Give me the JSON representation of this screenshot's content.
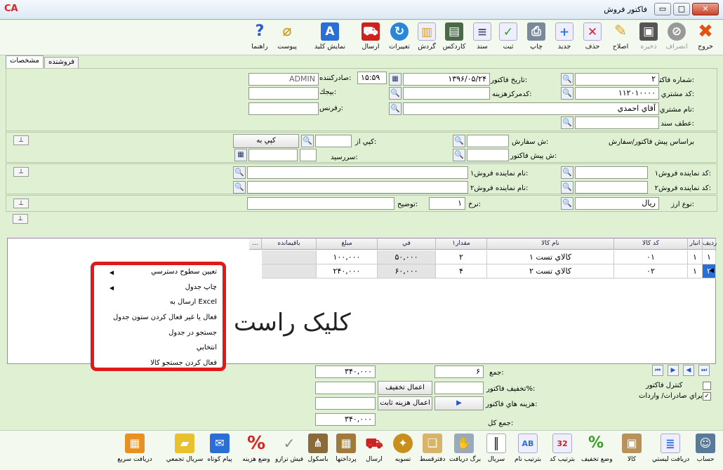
{
  "window": {
    "title": "فاکتور فروش",
    "logo": "CA"
  },
  "toolbar": {
    "exit": "خروج",
    "cancel": "انصراف",
    "save": "ذخيره",
    "edit": "اصلاح",
    "delete": "حذف",
    "new": "جديد",
    "print": "چاپ",
    "register": "ثبت",
    "document": "سند",
    "cardex": "کاردکس",
    "turnover": "گردش",
    "changes": "تغييرات",
    "send": "ارسال",
    "show_keys": "نمايش کليد",
    "attachment": "پيوست",
    "help": "راهنما"
  },
  "tabs": {
    "specs": "مشخصات",
    "seller": "فروشنده"
  },
  "header": {
    "invoice_no_label": "شماره فاکتور:",
    "invoice_no": "۲",
    "invoice_date_label": "تاريخ فاکتور:",
    "invoice_date": "۱۳۹۶/۰۵/۲۴",
    "time": "۱۵:۵۹",
    "issuer_label": "صادرکننده:",
    "issuer": "ADMIN",
    "customer_code_label": "کد مشتري:",
    "customer_code": "۱۱۲۰۱۰۰۰۰",
    "cost_center_label": "کدمرکزهزينه:",
    "budget_label": "بيجك:",
    "customer_name_label": "نام مشتري:",
    "customer_name": "آقاي احمدي",
    "reference_label": "رفرنس:",
    "doc_ref_label": "عطف سند:"
  },
  "order": {
    "based_on_label": "براساس پيش فاکتور/سفارش",
    "order_no_label": "ش سفارش:",
    "proforma_no_label": "ش پيش فاکتور:",
    "copy_from_label": "کپي از:",
    "copy_to_button": "کپي به",
    "due_label": "سررسيد:"
  },
  "sales_rep": {
    "code1_label": "کد نماينده فروش۱:",
    "name1_label": "نام نماينده فروش۱:",
    "code2_label": "کد نماينده فروش۲:",
    "name2_label": "نام نماينده فروش۲:"
  },
  "currency": {
    "type_label": "نوع ارز:",
    "type": "ريال",
    "rate_label": "نرخ:",
    "rate": "۱",
    "desc_label": "توضيح:"
  },
  "grid": {
    "columns": [
      "رديف",
      "انبار",
      "کد کالا",
      "نام کالا",
      "مقدار۱",
      "في",
      "مبلغ",
      "باقيمانده",
      "..."
    ],
    "rows": [
      {
        "row": "۱",
        "warehouse": "۱",
        "code": "۰۱",
        "name": "کالاي تست ۱",
        "qty": "۲",
        "price": "۵۰,۰۰۰",
        "amount": "۱۰۰,۰۰۰",
        "remain": ""
      },
      {
        "row": "۲",
        "warehouse": "۱",
        "code": "۰۲",
        "name": "کالاي تست ۲",
        "qty": "۴",
        "price": "۶۰,۰۰۰",
        "amount": "۲۴۰,۰۰۰",
        "remain": ""
      }
    ]
  },
  "context_menu": {
    "access_levels": "تعيين سطوح دسترسي",
    "print_table": "چاپ جدول",
    "send_excel": "ارسال به Excel",
    "toggle_column": "فعال يا غير فعال کردن ستون جدول",
    "search_table": "جستجو در جدول",
    "selective": "انتخابي",
    "enable_item_search": "فعال کردن جستجو کالا"
  },
  "annotation": "کليک راست",
  "footer": {
    "sum_label": "جمع:",
    "sum_count": "۶",
    "sum_amount": "۳۴۰,۰۰۰",
    "discount_label": "تخفيف فاکتور%:",
    "apply_discount": "اعمال تخفيف",
    "costs_label": "هزينه هاي فاکتور:",
    "apply_fixed_cost": "اعمال هزينه ثابت",
    "total_label": "جمع کل:",
    "total": "۳۴۰,۰۰۰",
    "control_invoice": "کنترل فاکتور",
    "for_import_export": "براي صادرات/ واردات"
  },
  "bottom_toolbar": {
    "acct": "حساب",
    "list_receive": "دريافت ليستي",
    "goods": "کالا",
    "discount_status": "وضع تخفيف",
    "sort_code": "بترتيب کد",
    "sort_name": "بترتيب نام",
    "serial": "سريال",
    "receipt": "برگ دريافت",
    "receipt_book": "دفترقسط",
    "settle": "تسويه",
    "send": "ارسال",
    "payments": "پرداختها",
    "bascule": "باسکول",
    "scale_slip": "فيش ترازو",
    "cost_status": "وضع هزينه",
    "sms": "پيام کوتاه",
    "bulk_serial": "سريال تجمعي",
    "quick_receive": "دريافت سريع"
  }
}
